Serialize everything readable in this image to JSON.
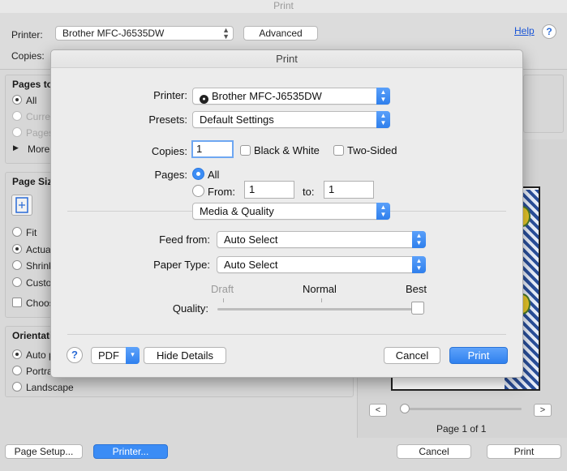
{
  "background_window": {
    "title": "Print",
    "printer_label": "Printer:",
    "printer_value": "Brother MFC-J6535DW",
    "advanced_button": "Advanced",
    "help_link": "Help",
    "help_icon": "?",
    "copies_label": "Copies:",
    "pages_panel": {
      "title": "Pages to",
      "options": [
        "All",
        "Curren",
        "Pages",
        "More"
      ]
    },
    "page_size_panel": {
      "title": "Page Siz",
      "options": [
        "Fit",
        "Actua",
        "Shrink",
        "Custo",
        "Choos"
      ]
    },
    "orientation_panel": {
      "title": "Orientatio",
      "options": [
        "Auto p",
        "Portra",
        "Landscape"
      ]
    },
    "preview": {
      "page_counter": "Page 1 of 1",
      "prev_icon": "<",
      "next_icon": ">"
    },
    "buttons": {
      "page_setup": "Page Setup...",
      "printer": "Printer...",
      "cancel": "Cancel",
      "print": "Print"
    }
  },
  "sheet": {
    "title": "Print",
    "printer_label": "Printer:",
    "printer_value": "Brother MFC-J6535DW",
    "presets_label": "Presets:",
    "presets_value": "Default Settings",
    "copies_label": "Copies:",
    "copies_value": "1",
    "bw_label": "Black & White",
    "two_sided_label": "Two-Sided",
    "pages_label": "Pages:",
    "pages_all_label": "All",
    "pages_from_label": "From:",
    "pages_from_value": "1",
    "pages_to_label": "to:",
    "pages_to_value": "1",
    "section_value": "Media & Quality",
    "feed_from_label": "Feed from:",
    "feed_from_value": "Auto Select",
    "paper_type_label": "Paper Type:",
    "paper_type_value": "Auto Select",
    "quality_label": "Quality:",
    "quality_ticks": [
      "Draft",
      "Normal",
      "Best"
    ],
    "quality_selected": "Best",
    "help_icon": "?",
    "pdf_label": "PDF",
    "hide_details_label": "Hide Details",
    "cancel_label": "Cancel",
    "print_label": "Print"
  }
}
